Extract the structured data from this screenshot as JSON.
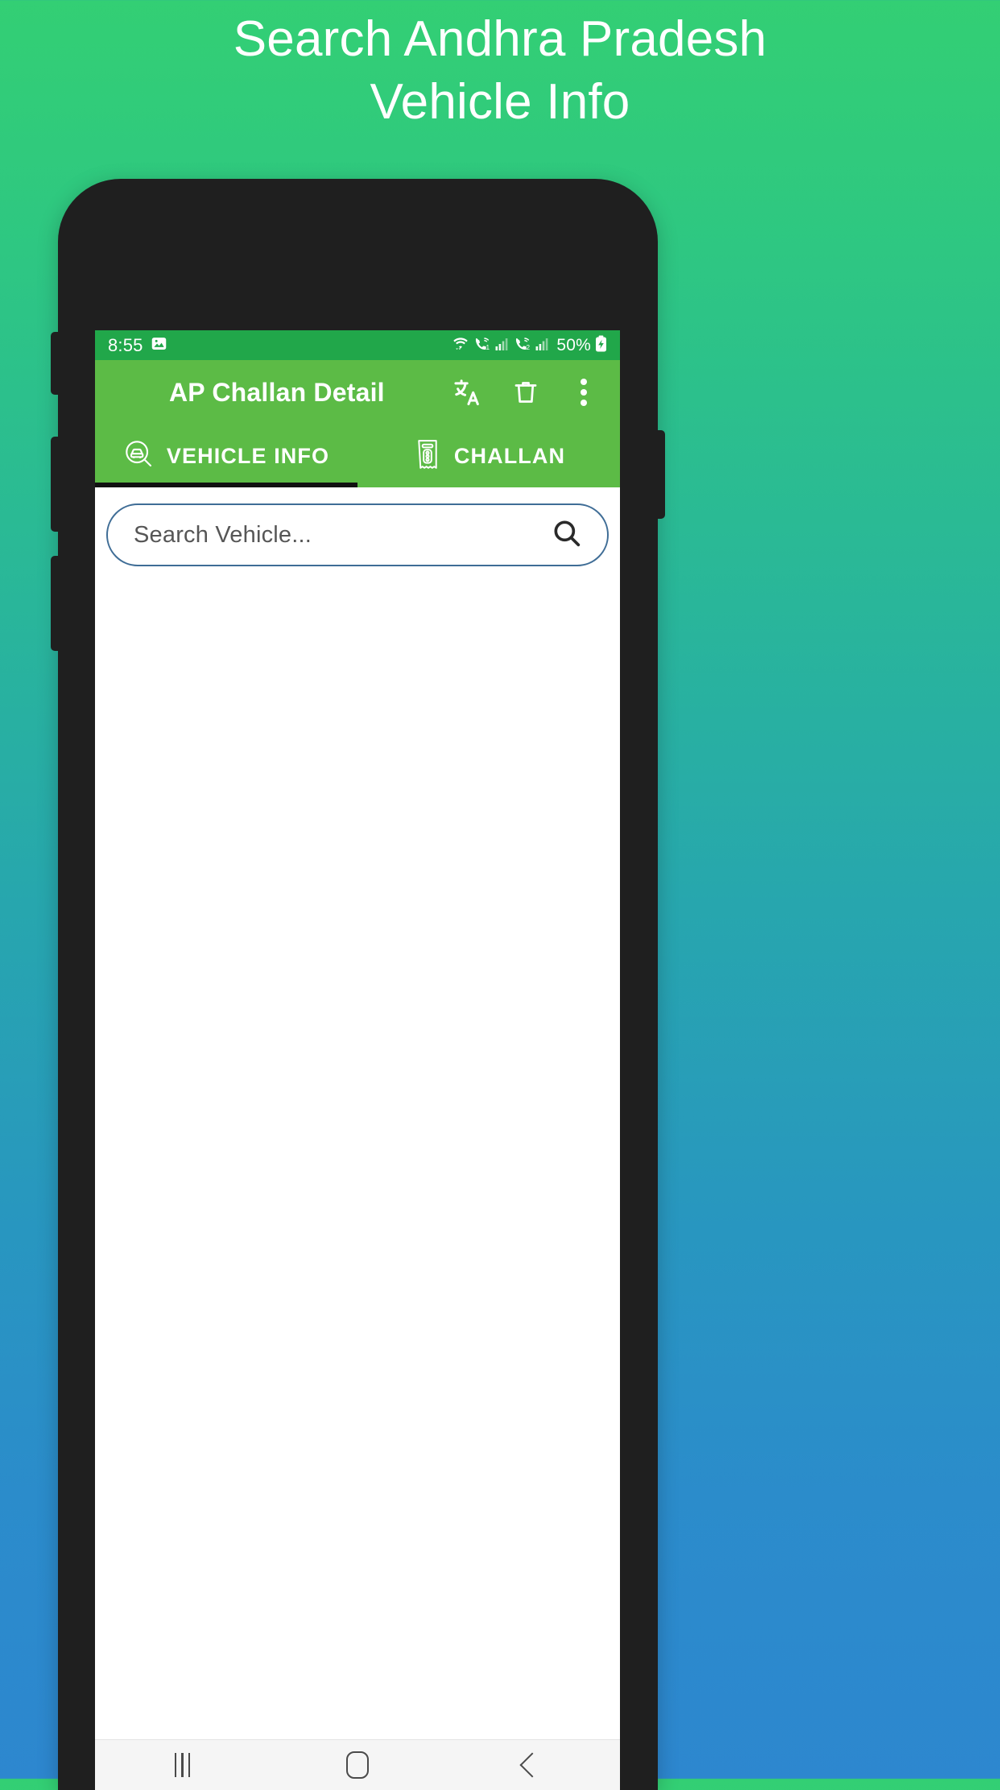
{
  "promo": {
    "headline_line1": "Search Andhra Pradesh",
    "headline_line2": "Vehicle Info",
    "bg_gradient_top": "#33cf74",
    "bg_gradient_bottom": "#2d87cf"
  },
  "phone": {
    "frame_color": "#1f1f1f"
  },
  "status_bar": {
    "time": "8:55",
    "battery": "50%",
    "background": "#21a74a",
    "icons": [
      "image-icon",
      "wifi-icon",
      "call-wifi-1-icon",
      "signal-1-icon",
      "call-wifi-2-icon",
      "signal-2-icon",
      "battery-charging-icon"
    ]
  },
  "app_bar": {
    "title": "AP Challan Detail",
    "background": "#5cbb46",
    "actions": [
      {
        "name": "translate-icon",
        "label": "Translate"
      },
      {
        "name": "delete-icon",
        "label": "Delete"
      },
      {
        "name": "overflow-menu-icon",
        "label": "More options"
      }
    ]
  },
  "tabs": {
    "active_index": 0,
    "indicator_color": "#111111",
    "items": [
      {
        "label": "VEHICLE INFO",
        "icon": "vehicle-search-icon"
      },
      {
        "label": "CHALLAN",
        "icon": "challan-receipt-icon"
      }
    ]
  },
  "search": {
    "placeholder": "Search Vehicle...",
    "value": "",
    "icon": "search-icon",
    "border_color": "#3f6d96"
  },
  "nav_bar": {
    "background": "#f5f5f5",
    "buttons": [
      {
        "name": "recents-button",
        "label": "Recents"
      },
      {
        "name": "home-button",
        "label": "Home"
      },
      {
        "name": "back-button",
        "label": "Back"
      }
    ]
  }
}
